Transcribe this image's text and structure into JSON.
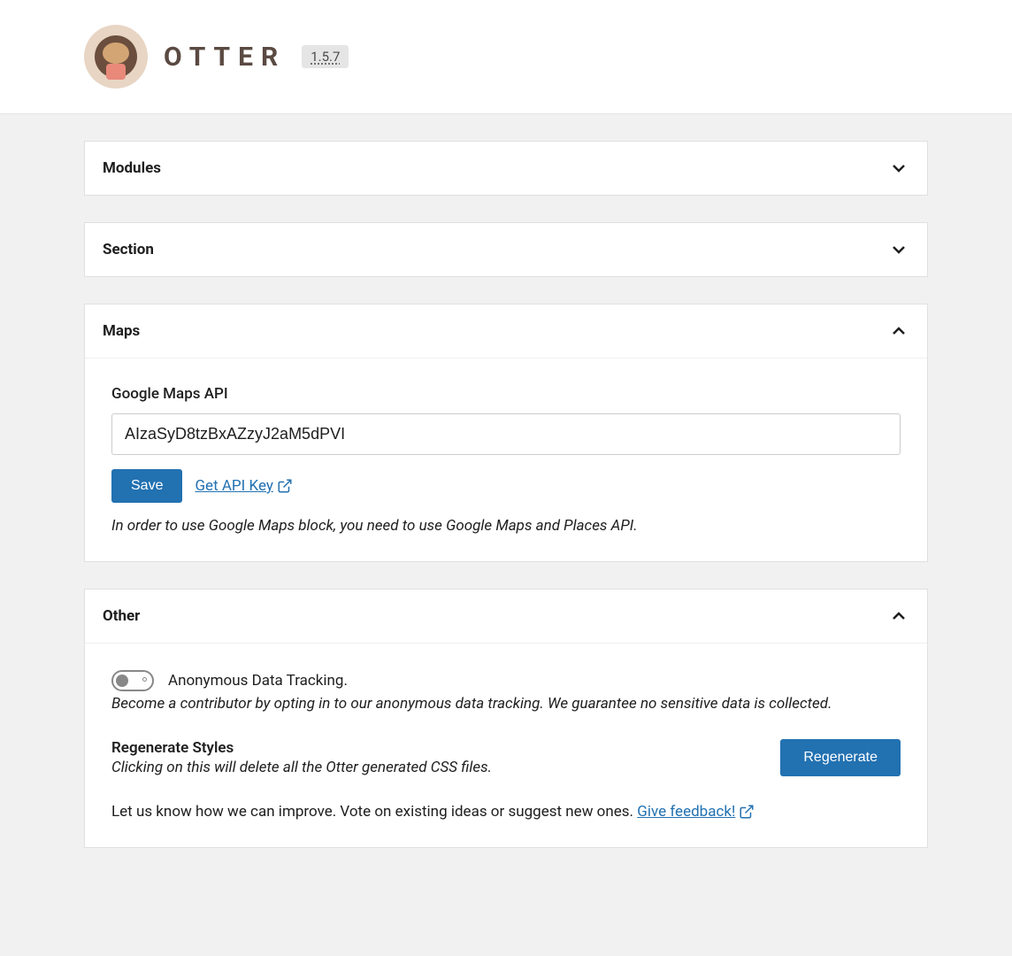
{
  "header": {
    "brand": "OTTER",
    "version": "1.5.7"
  },
  "panels": {
    "modules": {
      "title": "Modules",
      "expanded": false
    },
    "section": {
      "title": "Section",
      "expanded": false
    },
    "maps": {
      "title": "Maps",
      "expanded": true,
      "api_label": "Google Maps API",
      "api_value": "AIzaSyD8tzBxAZzyJ2aM5dPVI",
      "save_label": "Save",
      "get_key_label": "Get API Key",
      "help_text": "In order to use Google Maps block, you need to use Google Maps and Places API."
    },
    "other": {
      "title": "Other",
      "expanded": true,
      "tracking_label": "Anonymous Data Tracking.",
      "tracking_help": "Become a contributor by opting in to our anonymous data tracking. We guarantee no sensitive data is collected.",
      "tracking_on": false,
      "regen_title": "Regenerate Styles",
      "regen_help": "Clicking on this will delete all the Otter generated CSS files.",
      "regen_button": "Regenerate",
      "feedback_text": "Let us know how we can improve. Vote on existing ideas or suggest new ones. ",
      "feedback_link": "Give feedback!"
    }
  }
}
